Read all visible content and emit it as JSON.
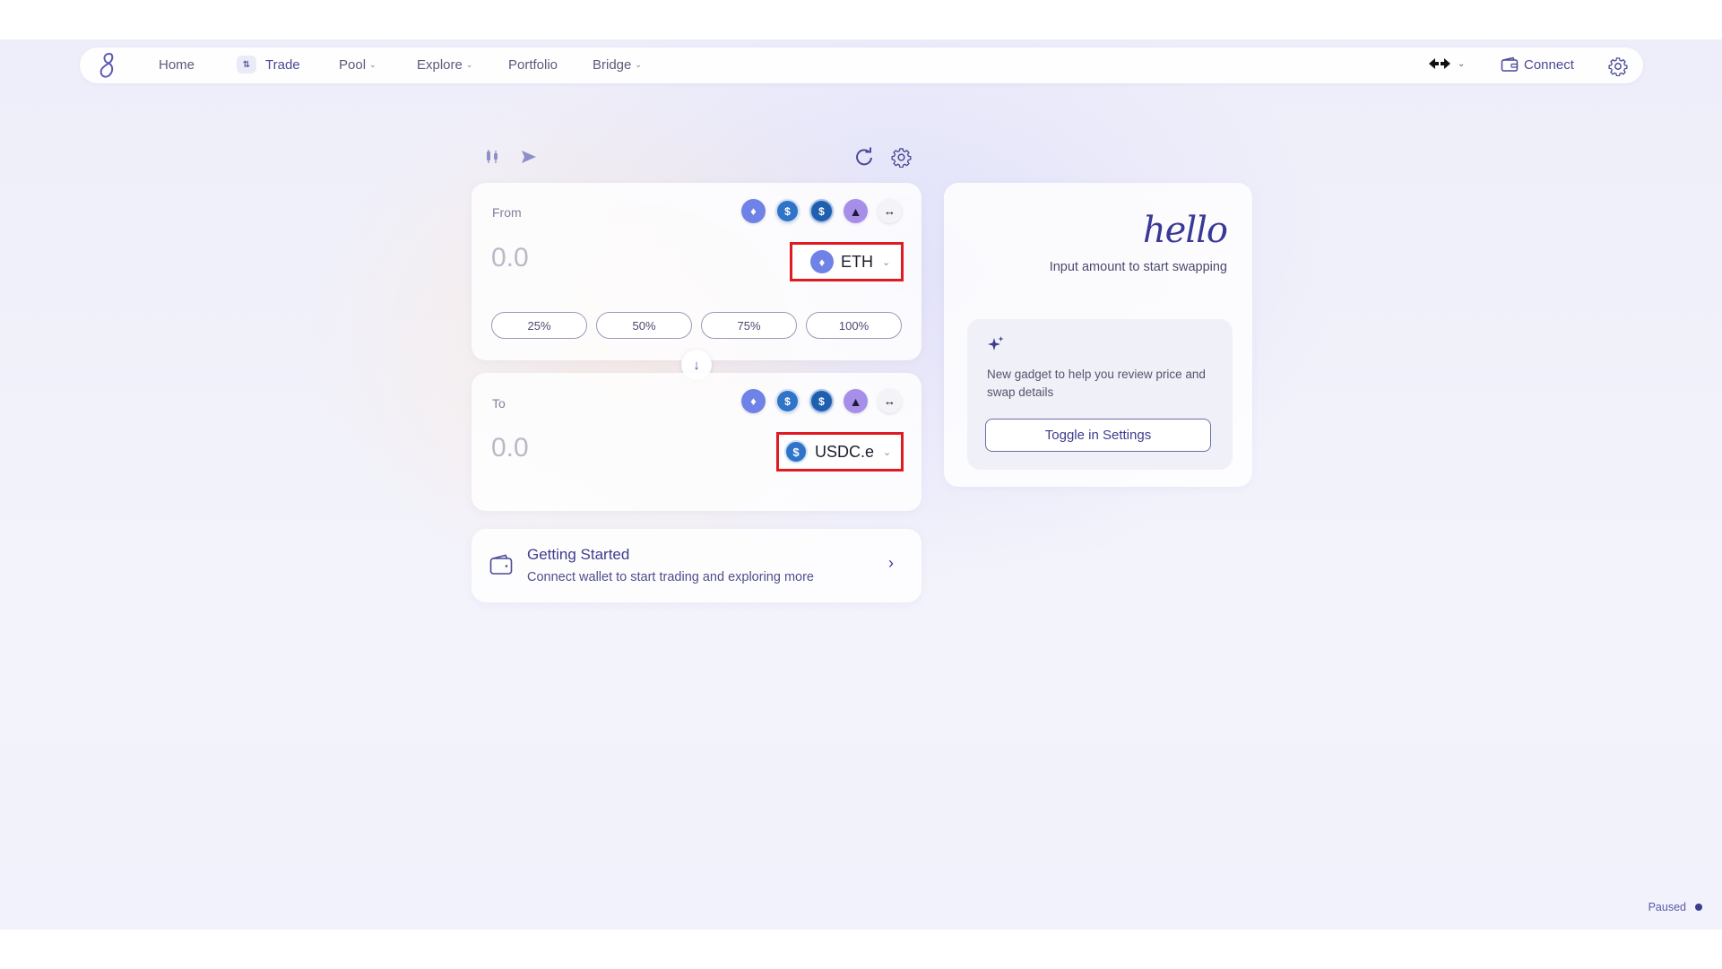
{
  "nav": {
    "items": [
      {
        "label": "Home"
      },
      {
        "label": "Trade"
      },
      {
        "label": "Pool"
      },
      {
        "label": "Explore"
      },
      {
        "label": "Portfolio"
      },
      {
        "label": "Bridge"
      }
    ],
    "network_icon": "network-arrows-icon",
    "connect_label": "Connect"
  },
  "from": {
    "label": "From",
    "amount": "0.0",
    "token": "ETH",
    "quick_tokens": [
      "eth-icon",
      "usdc-icon",
      "usdc-e-icon",
      "arb-icon",
      "network-arrows-icon"
    ],
    "percents": [
      "25%",
      "50%",
      "75%",
      "100%"
    ]
  },
  "to": {
    "label": "To",
    "amount": "0.0",
    "token": "USDC.e",
    "quick_tokens": [
      "eth-icon",
      "usdc-icon",
      "usdc-e-icon",
      "arb-icon",
      "network-arrows-icon"
    ]
  },
  "getting_started": {
    "title": "Getting Started",
    "subtitle": "Connect wallet to start trading and exploring more"
  },
  "side_panel": {
    "hello": "hello",
    "subtitle": "Input amount to start swapping",
    "gadget_text": "New gadget to help you review price and swap details",
    "toggle_label": "Toggle in Settings"
  },
  "status": {
    "paused": "Paused"
  },
  "colors": {
    "accent": "#3d3c8f",
    "highlight_box": "#e01a22",
    "eth": "#6f82e8",
    "usdc": "#2f74c7"
  }
}
